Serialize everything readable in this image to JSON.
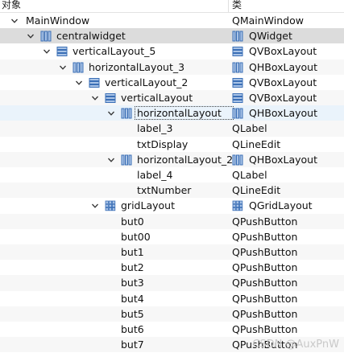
{
  "header": {
    "object_col": "对象",
    "class_col": "类"
  },
  "rows": [
    {
      "name": "MainWindow",
      "cls": "QMainWindow",
      "expander": "open"
    },
    {
      "name": "centralwidget",
      "cls": "QWidget",
      "expander": "open",
      "icon": "widget-icon",
      "selected": true
    },
    {
      "name": "verticalLayout_5",
      "cls": "QVBoxLayout",
      "expander": "open",
      "icon": "vbox-layout-icon"
    },
    {
      "name": "horizontalLayout_3",
      "cls": "QHBoxLayout",
      "expander": "open",
      "icon": "hbox-layout-icon"
    },
    {
      "name": "verticalLayout_2",
      "cls": "QVBoxLayout",
      "expander": "open",
      "icon": "vbox-layout-icon"
    },
    {
      "name": "verticalLayout",
      "cls": "QVBoxLayout",
      "expander": "open",
      "icon": "vbox-layout-icon"
    },
    {
      "name": "horizontalLayout",
      "cls": "QHBoxLayout",
      "expander": "open",
      "icon": "hbox-layout-icon",
      "hover": true
    },
    {
      "name": "label_3",
      "cls": "QLabel"
    },
    {
      "name": "txtDisplay",
      "cls": "QLineEdit"
    },
    {
      "name": "horizontalLayout_2",
      "cls": "QHBoxLayout",
      "expander": "open",
      "icon": "hbox-layout-icon"
    },
    {
      "name": "label_4",
      "cls": "QLabel"
    },
    {
      "name": "txtNumber",
      "cls": "QLineEdit"
    },
    {
      "name": "gridLayout",
      "cls": "QGridLayout",
      "expander": "open",
      "icon": "grid-layout-icon"
    },
    {
      "name": "but0",
      "cls": "QPushButton"
    },
    {
      "name": "but00",
      "cls": "QPushButton"
    },
    {
      "name": "but1",
      "cls": "QPushButton"
    },
    {
      "name": "but2",
      "cls": "QPushButton"
    },
    {
      "name": "but3",
      "cls": "QPushButton"
    },
    {
      "name": "but4",
      "cls": "QPushButton"
    },
    {
      "name": "but5",
      "cls": "QPushButton"
    },
    {
      "name": "but6",
      "cls": "QPushButton"
    },
    {
      "name": "but7",
      "cls": "QPushButton"
    }
  ],
  "watermark": "CSDN @AuxPnW",
  "colors": {
    "icon_blue": "#3b6fb6",
    "icon_blue_light": "#a9c3e6",
    "selection": "#dcdcdc",
    "hover": "#eaf3fb"
  }
}
